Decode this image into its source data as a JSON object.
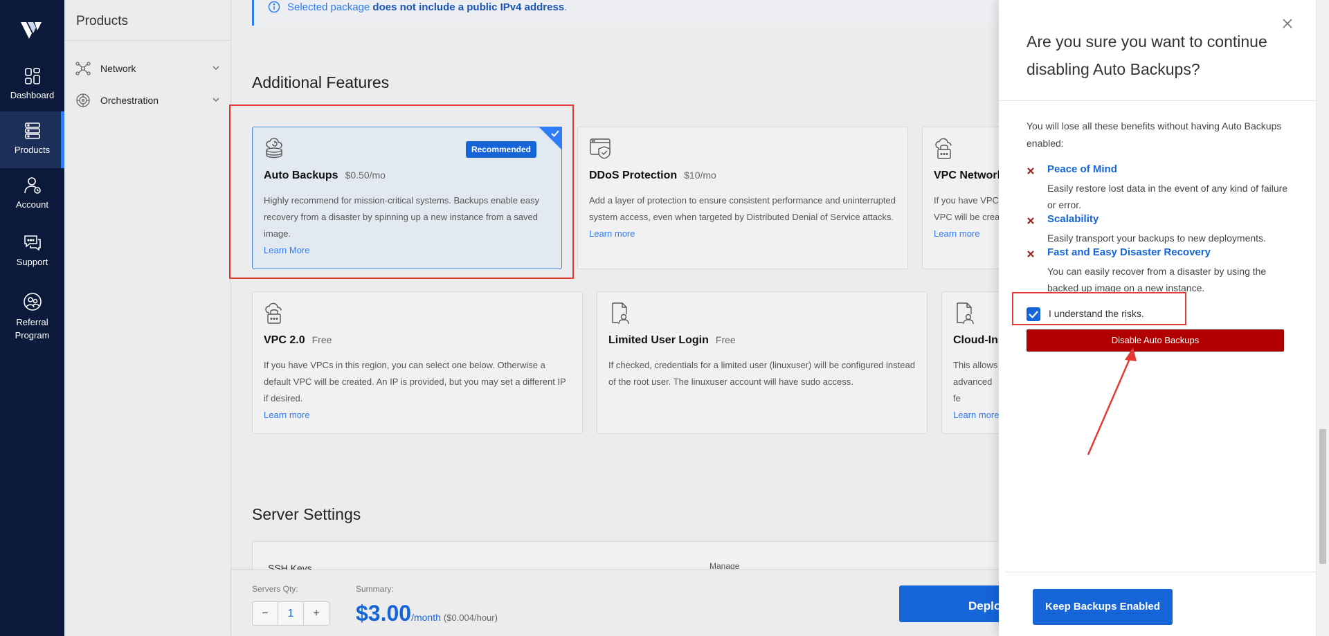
{
  "rail": {
    "items": [
      {
        "label": "Dashboard",
        "icon": "dashboard-icon"
      },
      {
        "label": "Products",
        "icon": "products-icon"
      },
      {
        "label": "Account",
        "icon": "account-icon"
      },
      {
        "label": "Support",
        "icon": "support-icon"
      },
      {
        "label": "Referral Program",
        "icon": "referral-icon"
      }
    ]
  },
  "sidebar": {
    "title": "Products",
    "items": [
      {
        "label": "Network",
        "icon": "network-icon"
      },
      {
        "label": "Orchestration",
        "icon": "orchestration-icon"
      }
    ]
  },
  "notice": {
    "prefix": "Selected package ",
    "bold": "does not include a public IPv4 address",
    "suffix": "."
  },
  "features": {
    "title": "Additional Features",
    "cards": [
      {
        "title": "Auto Backups",
        "price": "$0.50/mo",
        "badge": "Recommended",
        "desc": "Highly recommend for mission-critical systems. Backups enable easy recovery from a disaster by spinning up a new instance from a saved image.",
        "link": "Learn More"
      },
      {
        "title": "DDoS Protection",
        "price": "$10/mo",
        "desc": "Add a layer of protection to ensure consistent performance and uninterrupted system access, even when targeted by Distributed Denial of Service attacks.",
        "link": "Learn more"
      },
      {
        "title": "VPC Network",
        "price": "",
        "desc": "If you have VPCs VPC will be crea",
        "link": "Learn more"
      },
      {
        "title": "VPC 2.0",
        "price": "Free",
        "desc": "If you have VPCs in this region, you can select one below. Otherwise a default VPC will be created. An IP is provided, but you may set a different IP if desired.",
        "link": "Learn more"
      },
      {
        "title": "Limited User Login",
        "price": "Free",
        "desc": "If checked, credentials for a limited user (linuxuser) will be configured instead of the root user. The linuxuser account will have sudo access.",
        "link": ""
      },
      {
        "title": "Cloud-Ini",
        "price": "",
        "desc": "This allows advanced fe",
        "link": "Learn more"
      }
    ]
  },
  "server_settings": {
    "title": "Server Settings",
    "ssh_label": "SSH Keys",
    "manage_label": "Manage"
  },
  "footer": {
    "qty_label": "Servers Qty:",
    "qty_minus": "−",
    "qty_value": "1",
    "qty_plus": "+",
    "summary_label": "Summary:",
    "price": "$3.00",
    "per_month": "/month",
    "per_hour": "($0.004/hour)",
    "deploy_label": "Deplo"
  },
  "panel": {
    "title": "Are you sure you want to continue disabling Auto Backups?",
    "intro": "You will lose all these benefits without having Auto Backups enabled:",
    "benefits": [
      {
        "title": "Peace of Mind",
        "desc": "Easily restore lost data in the event of any kind of failure or error."
      },
      {
        "title": "Scalability",
        "desc": "Easily transport your backups to new deployments."
      },
      {
        "title": "Fast and Easy Disaster Recovery",
        "desc": "You can easily recover from a disaster by using the backed up image on a new instance."
      }
    ],
    "checkbox_label": "I understand the risks.",
    "checkbox_checked": true,
    "disable_button": "Disable Auto Backups",
    "keep_button": "Keep Backups Enabled"
  },
  "colors": {
    "accent": "#1565d8",
    "danger": "#b00000",
    "rail_bg": "#0b1a3a",
    "highlight": "#e53935"
  }
}
